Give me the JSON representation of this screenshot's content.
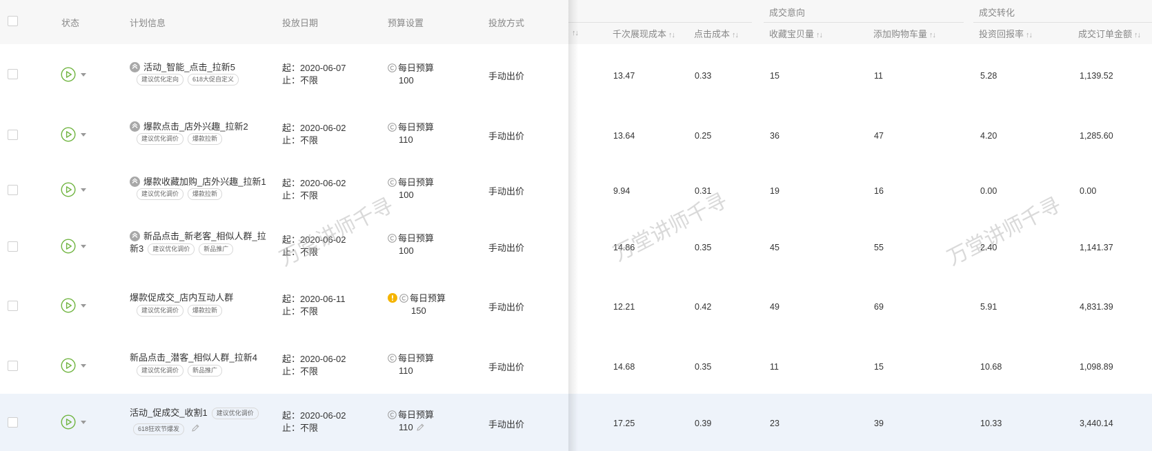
{
  "header": {
    "status": "状态",
    "plan_info": "计划信息",
    "date": "投放日期",
    "budget": "预算设置",
    "bid_method": "投放方式",
    "groups": {
      "intent": "成交意向",
      "conversion": "成交转化"
    },
    "cols": {
      "truncated": "",
      "cpm": "千次展现成本",
      "cpc": "点击成本",
      "fav_count": "收藏宝贝量",
      "cart_count": "添加购物车量",
      "roi": "投资回报率",
      "gmv": "成交订单金额"
    },
    "sort_glyph": "↑↓"
  },
  "date_labels": {
    "start": "起：",
    "end": "止："
  },
  "rows": [
    {
      "name": "活动_智能_点击_拉新5",
      "tags": [
        "建议优化定向",
        "618大促自定义"
      ],
      "start": "2020-06-07",
      "end": "不限",
      "budget_label": "每日预算",
      "budget": "100",
      "bid": "手动出价",
      "cpm": "13.47",
      "cpc": "0.33",
      "fav": "15",
      "cart": "11",
      "roi": "5.28",
      "gmv": "1,139.52"
    },
    {
      "name": "爆款点击_店外兴趣_拉新2",
      "tags": [
        "建议优化调价",
        "爆款拉新"
      ],
      "start": "2020-06-02",
      "end": "不限",
      "budget_label": "每日预算",
      "budget": "110",
      "bid": "手动出价",
      "cpm": "13.64",
      "cpc": "0.25",
      "fav": "36",
      "cart": "47",
      "roi": "4.20",
      "gmv": "1,285.60"
    },
    {
      "name": "爆款收藏加购_店外兴趣_拉新1",
      "tags": [
        "建议优化调价",
        "爆款拉新"
      ],
      "start": "2020-06-02",
      "end": "不限",
      "budget_label": "每日预算",
      "budget": "100",
      "bid": "手动出价",
      "cpm": "9.94",
      "cpc": "0.31",
      "fav": "19",
      "cart": "16",
      "roi": "0.00",
      "gmv": "0.00"
    },
    {
      "name": "新品点击_新老客_相似人群_拉新3",
      "tags": [
        "建议优化调价",
        "新品推广"
      ],
      "start": "2020-06-02",
      "end": "不限",
      "budget_label": "每日预算",
      "budget": "100",
      "bid": "手动出价",
      "cpm": "14.86",
      "cpc": "0.35",
      "fav": "45",
      "cart": "55",
      "roi": "2.40",
      "gmv": "1,141.37"
    },
    {
      "name": "爆款促成交_店内互动人群",
      "tags": [
        "建议优化调价",
        "爆款拉新"
      ],
      "start": "2020-06-11",
      "end": "不限",
      "budget_label": "每日预算",
      "budget": "150",
      "bid": "手动出价",
      "cpm": "12.21",
      "cpc": "0.42",
      "fav": "49",
      "cart": "69",
      "roi": "5.91",
      "gmv": "4,831.39"
    },
    {
      "name": "新品点击_潜客_相似人群_拉新4",
      "tags": [
        "建议优化调价",
        "新品推广"
      ],
      "start": "2020-06-02",
      "end": "不限",
      "budget_label": "每日预算",
      "budget": "110",
      "bid": "手动出价",
      "cpm": "14.68",
      "cpc": "0.35",
      "fav": "11",
      "cart": "15",
      "roi": "10.68",
      "gmv": "1,098.89"
    },
    {
      "name": "活动_促成交_收割1",
      "tags": [
        "建议优化调价",
        "618狂欢节爆发"
      ],
      "start": "2020-06-02",
      "end": "不限",
      "budget_label": "每日预算",
      "budget": "110",
      "bid": "手动出价",
      "cpm": "17.25",
      "cpc": "0.39",
      "fav": "23",
      "cart": "39",
      "roi": "10.33",
      "gmv": "3,440.14"
    }
  ],
  "watermark": "万堂讲师千寻",
  "colors": {
    "accent_green": "#6fb43f",
    "warning": "#f5b400",
    "header_bg": "#f7f7f7",
    "highlight_row": "#eef3fa"
  }
}
